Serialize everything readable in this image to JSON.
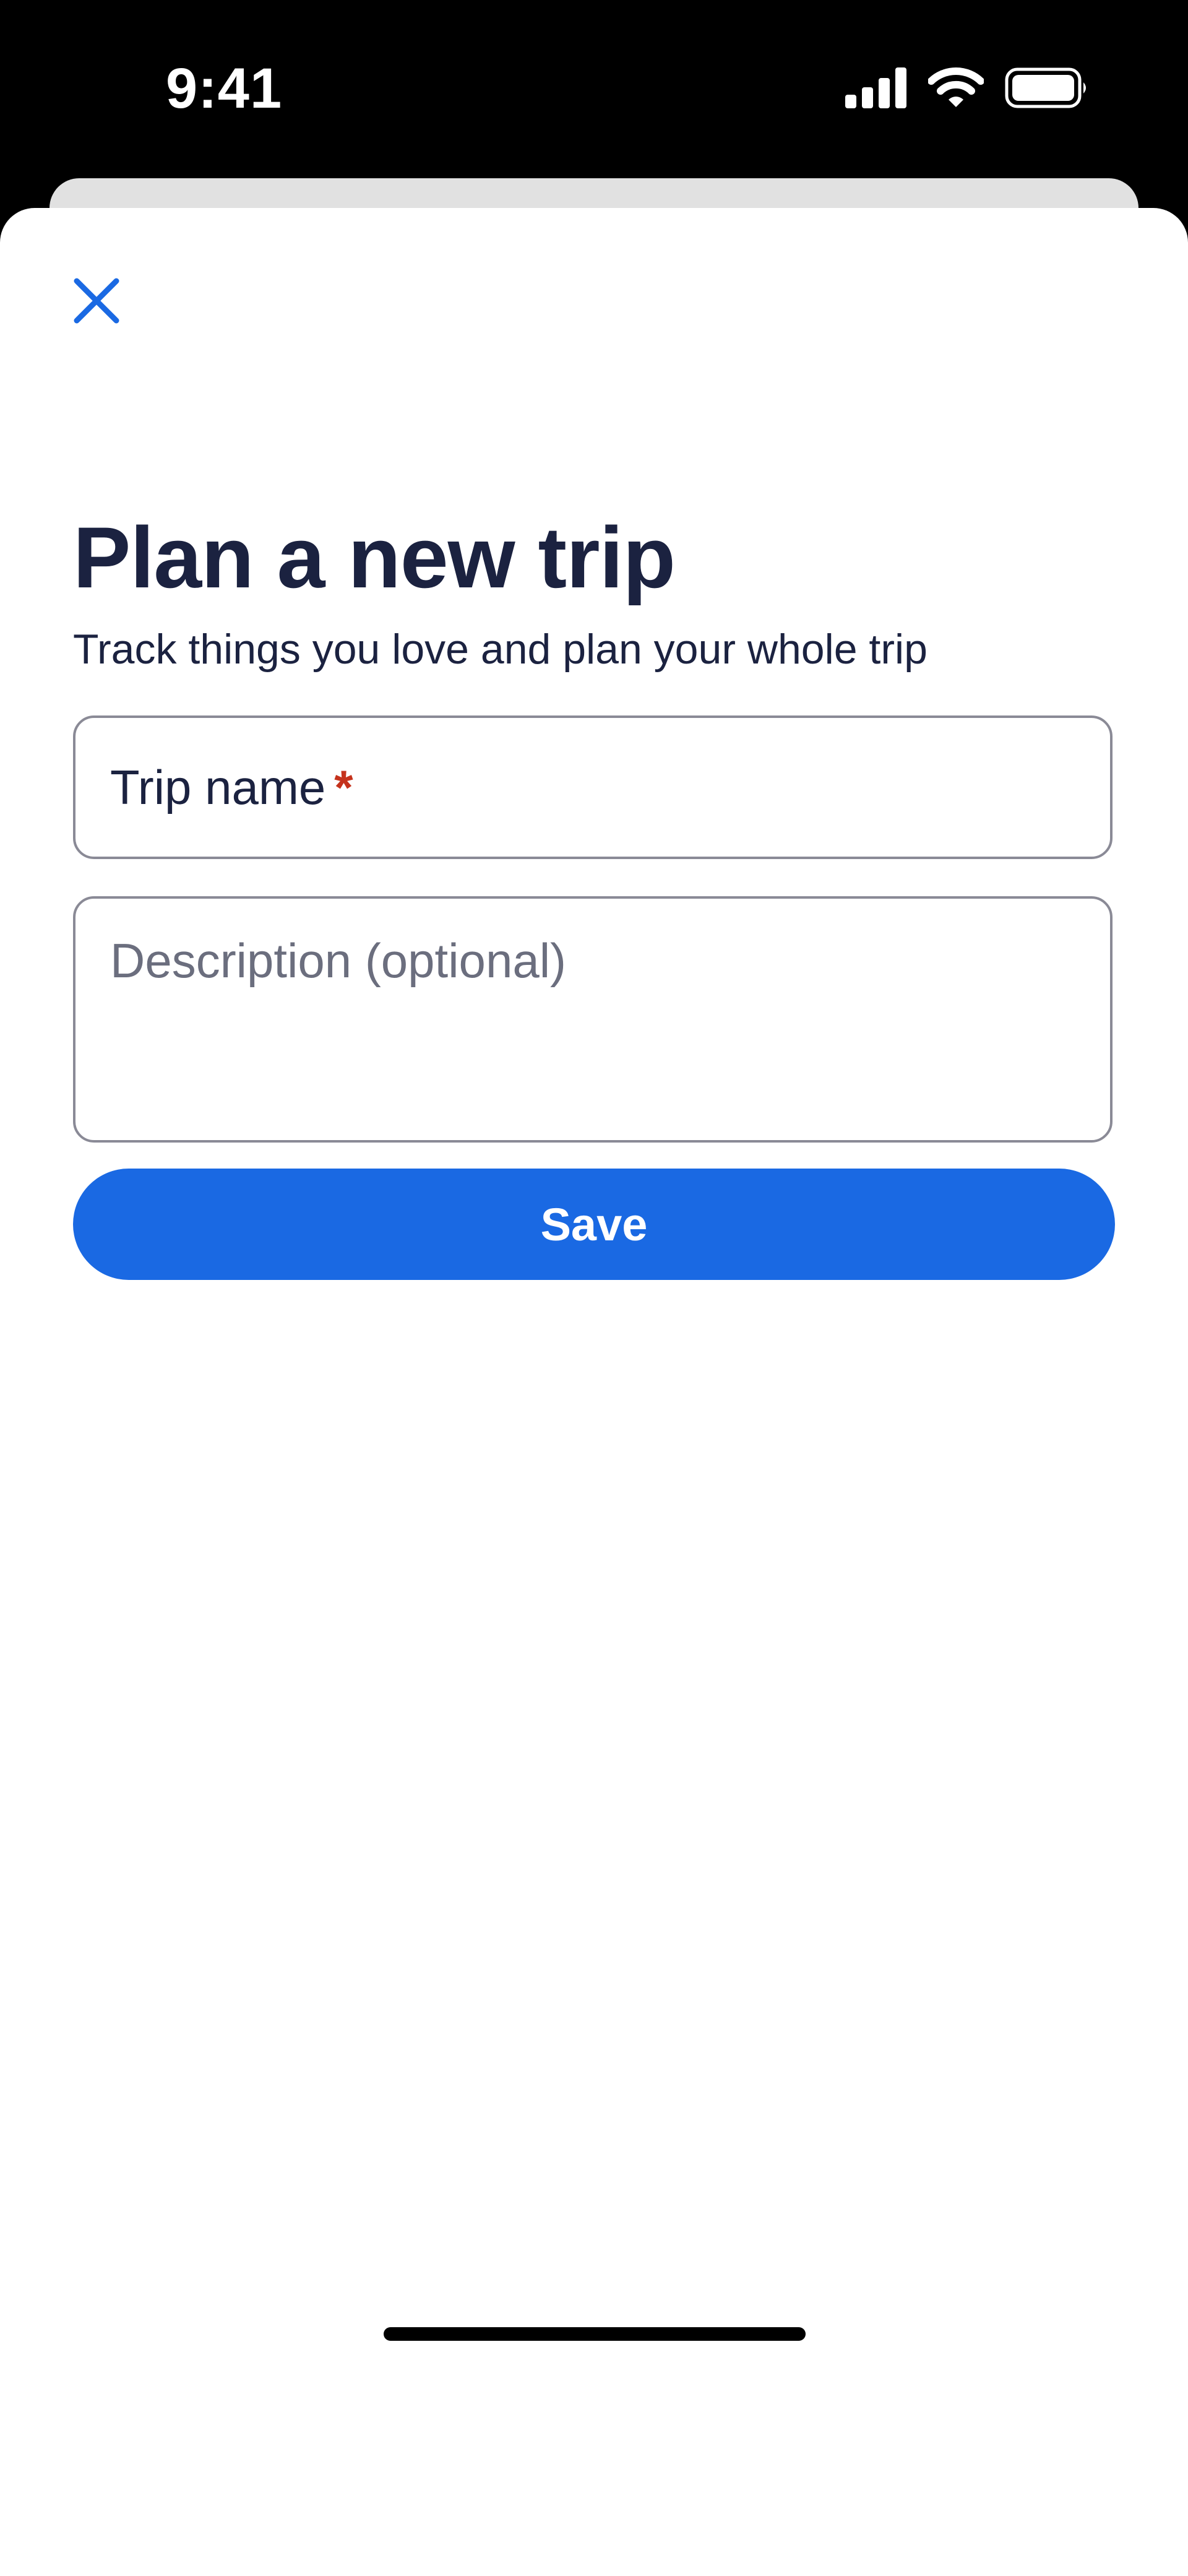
{
  "status_bar": {
    "time": "9:41",
    "icons": [
      "cellular-signal-icon",
      "wifi-icon",
      "battery-icon"
    ]
  },
  "sheet": {
    "close_icon": "close-icon",
    "title": "Plan a new trip",
    "subtitle": "Track things you love and plan your whole trip",
    "trip_name": {
      "label": "Trip name",
      "required_marker": "*",
      "value": ""
    },
    "description": {
      "placeholder": "Description (optional)",
      "value": ""
    },
    "save_label": "Save"
  },
  "colors": {
    "accent": "#1a69e3",
    "text_primary": "#1b2240",
    "placeholder": "#6b6e7e",
    "required": "#c5321c",
    "border": "#8a8a96"
  }
}
